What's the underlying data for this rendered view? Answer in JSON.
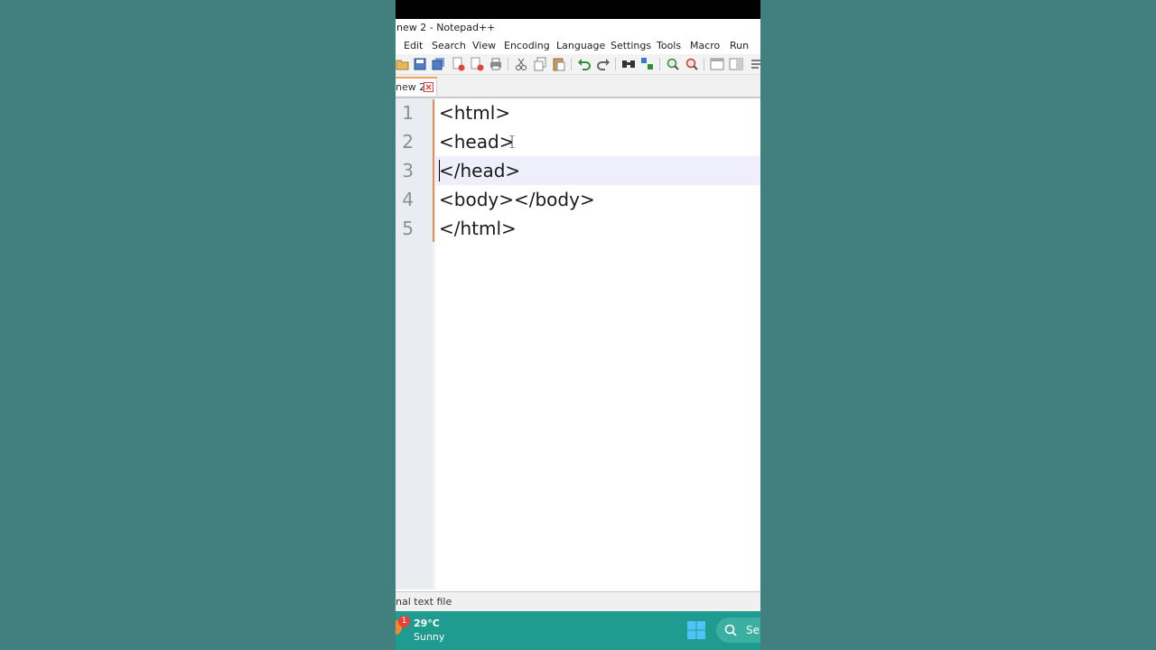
{
  "window": {
    "title": "new 2 - Notepad++"
  },
  "menu": [
    "Edit",
    "Search",
    "View",
    "Encoding",
    "Language",
    "Settings",
    "Tools",
    "Macro",
    "Run"
  ],
  "tabs": [
    {
      "label": "new 2",
      "active": true
    }
  ],
  "editor": {
    "lines": [
      {
        "num": "1",
        "text": "<html>"
      },
      {
        "num": "2",
        "text": "<head>"
      },
      {
        "num": "3",
        "text": "</head>"
      },
      {
        "num": "4",
        "text": "<body></body>"
      },
      {
        "num": "5",
        "text": "</html>"
      }
    ],
    "current_line": 3
  },
  "status": {
    "file_type": "nal text file"
  },
  "taskbar": {
    "weather_badge": "1",
    "temperature": "29°C",
    "condition": "Sunny",
    "search_label": "Se"
  },
  "colors": {
    "desktop_background": "#41807f",
    "taskbar": "#1f9c8f",
    "change_bar": "#f08a4b",
    "tab_accent": "#f2a15a",
    "close_icon": "#e0443e"
  },
  "toolbar_icons": [
    "open-icon",
    "save-icon",
    "save-all-icon",
    "close-file-icon",
    "close-all-icon",
    "print-icon",
    "cut-icon",
    "copy-icon",
    "paste-icon",
    "undo-icon",
    "redo-icon",
    "find-icon",
    "replace-icon",
    "zoom-in-icon",
    "zoom-out-icon",
    "sync-vertical-icon",
    "sync-horizontal-icon",
    "word-wrap-icon"
  ]
}
